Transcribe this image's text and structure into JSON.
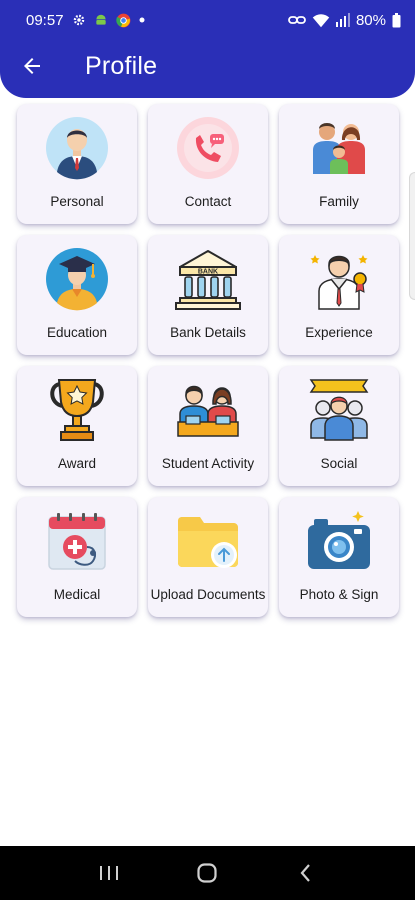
{
  "status_bar": {
    "time": "09:57",
    "battery_percent": "80%",
    "icons": [
      "gear-icon",
      "android-icon",
      "chrome-icon",
      "dot-icon",
      "link-icon",
      "wifi-icon",
      "signal-icon",
      "battery-icon"
    ]
  },
  "header": {
    "title": "Profile",
    "back_icon": "arrow-left-icon"
  },
  "colors": {
    "primary": "#2a2fb7",
    "card_bg": "#f6f3fb",
    "text": "#1d1d1d"
  },
  "menu": [
    {
      "label": "Personal",
      "icon": "person-icon"
    },
    {
      "label": "Contact",
      "icon": "phone-icon"
    },
    {
      "label": "Family",
      "icon": "family-icon"
    },
    {
      "label": "Education",
      "icon": "graduate-icon"
    },
    {
      "label": "Bank Details",
      "icon": "bank-icon"
    },
    {
      "label": "Experience",
      "icon": "experience-icon"
    },
    {
      "label": "Award",
      "icon": "trophy-icon"
    },
    {
      "label": "Student Activity",
      "icon": "students-icon"
    },
    {
      "label": "Social",
      "icon": "group-icon"
    },
    {
      "label": "Medical",
      "icon": "medical-calendar-icon"
    },
    {
      "label": "Upload Documents",
      "icon": "folder-upload-icon"
    },
    {
      "label": "Photo & Sign",
      "icon": "camera-icon"
    }
  ],
  "nav_bar": {
    "buttons": [
      "recent-apps-icon",
      "home-icon",
      "back-icon"
    ]
  }
}
